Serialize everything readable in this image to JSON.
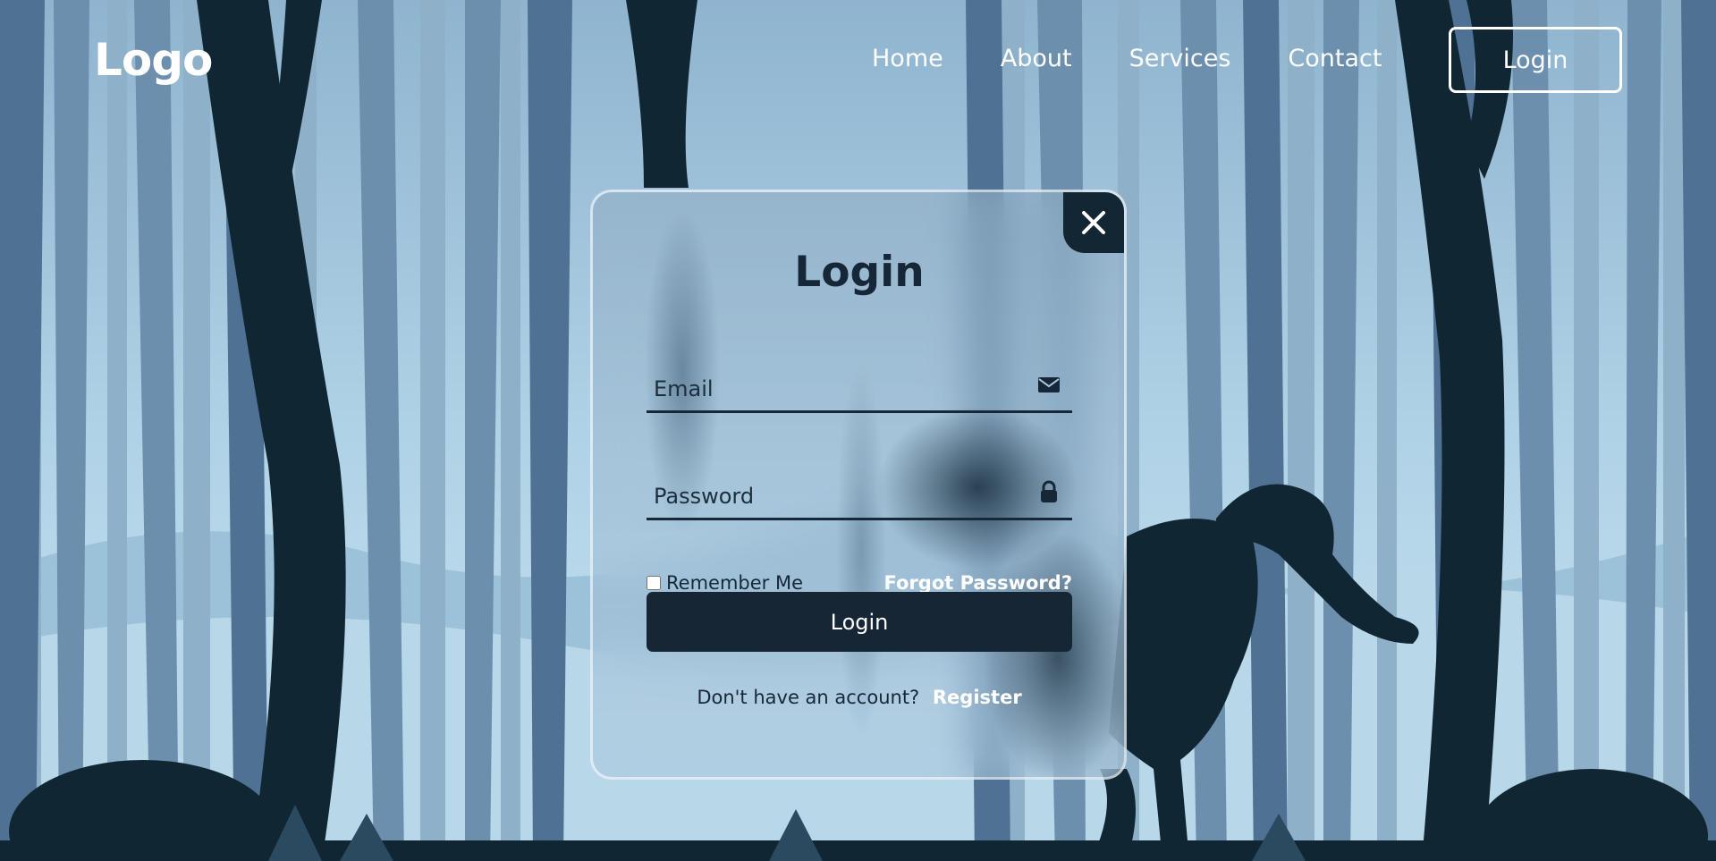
{
  "header": {
    "logo": "Logo",
    "nav": [
      "Home",
      "About",
      "Services",
      "Contact"
    ],
    "login_button": "Login"
  },
  "form": {
    "title": "Login",
    "email_placeholder": "Email",
    "password_placeholder": "Password",
    "remember_label": "Remember Me",
    "forgot_link": "Forgot Password?",
    "submit_label": "Login",
    "register_prompt": "Don't have an account?",
    "register_link": "Register"
  },
  "icons": {
    "close": "close-icon",
    "email": "mail-icon",
    "password": "lock-icon"
  },
  "colors": {
    "dark": "#162634",
    "sky": "#a9cbe0",
    "white": "#ffffff"
  }
}
